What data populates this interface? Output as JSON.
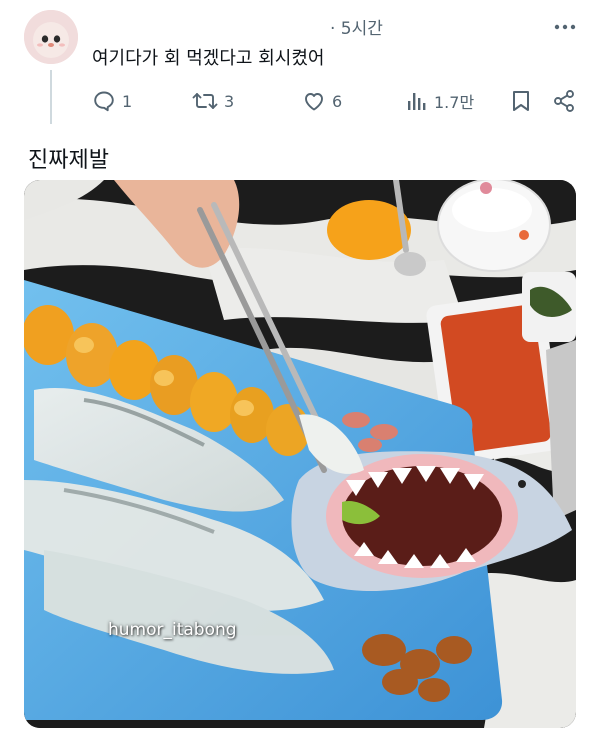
{
  "post": {
    "time": "· 5시간",
    "text": "여기다가 회 먹겠다고 회시켰어"
  },
  "actions": {
    "reply_count": "1",
    "repost_count": "3",
    "like_count": "6",
    "view_count": "1.7만"
  },
  "reply": {
    "text": "진짜제발"
  },
  "photo": {
    "watermark": "humor_itabong"
  },
  "colors": {
    "icon_gray": "#536471",
    "text": "#0f1419",
    "thread_line": "#cfd9de",
    "platter_blue": "#5aa8e0"
  },
  "icons": [
    "avatar",
    "more-icon",
    "reply-icon",
    "repost-icon",
    "like-icon",
    "views-icon",
    "bookmark-icon",
    "share-icon"
  ]
}
